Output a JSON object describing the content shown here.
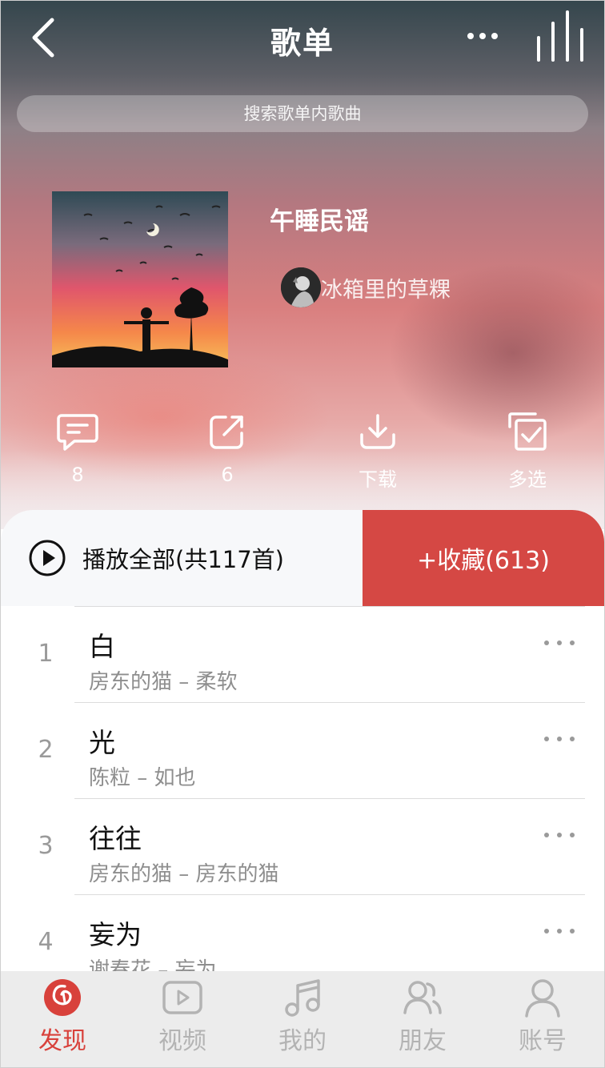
{
  "header": {
    "title": "歌单",
    "back_icon": "chevron-left-icon",
    "more_icon": "more-dots-icon",
    "playing_icon": "equalizer-icon"
  },
  "search": {
    "placeholder": "搜索歌单内歌曲"
  },
  "playlist": {
    "name": "午睡民谣",
    "creator": "冰箱里的草粿"
  },
  "actions": [
    {
      "icon": "comment-icon",
      "label": "8"
    },
    {
      "icon": "share-icon",
      "label": "6"
    },
    {
      "icon": "download-icon",
      "label": "下载"
    },
    {
      "icon": "multi-select-icon",
      "label": "多选"
    }
  ],
  "play_bar": {
    "play_all_label": "播放全部(共117首)",
    "collect_label": "+收藏(613)"
  },
  "songs": [
    {
      "index": "1",
      "title": "白",
      "subtitle": "房东的猫 – 柔软"
    },
    {
      "index": "2",
      "title": "光",
      "subtitle": "陈粒 – 如也"
    },
    {
      "index": "3",
      "title": "往往",
      "subtitle": "房东的猫 – 房东的猫"
    },
    {
      "index": "4",
      "title": "妄为",
      "subtitle": "谢春花 – 妄为"
    }
  ],
  "tabs": [
    {
      "icon": "netease-music-icon",
      "label": "发现",
      "active": true
    },
    {
      "icon": "video-icon",
      "label": "视频",
      "active": false
    },
    {
      "icon": "music-note-icon",
      "label": "我的",
      "active": false
    },
    {
      "icon": "friends-icon",
      "label": "朋友",
      "active": false
    },
    {
      "icon": "account-icon",
      "label": "账号",
      "active": false
    }
  ],
  "colors": {
    "accent": "#d54844",
    "tab_active": "#d8413b",
    "tab_inactive": "#b3b3b3"
  }
}
